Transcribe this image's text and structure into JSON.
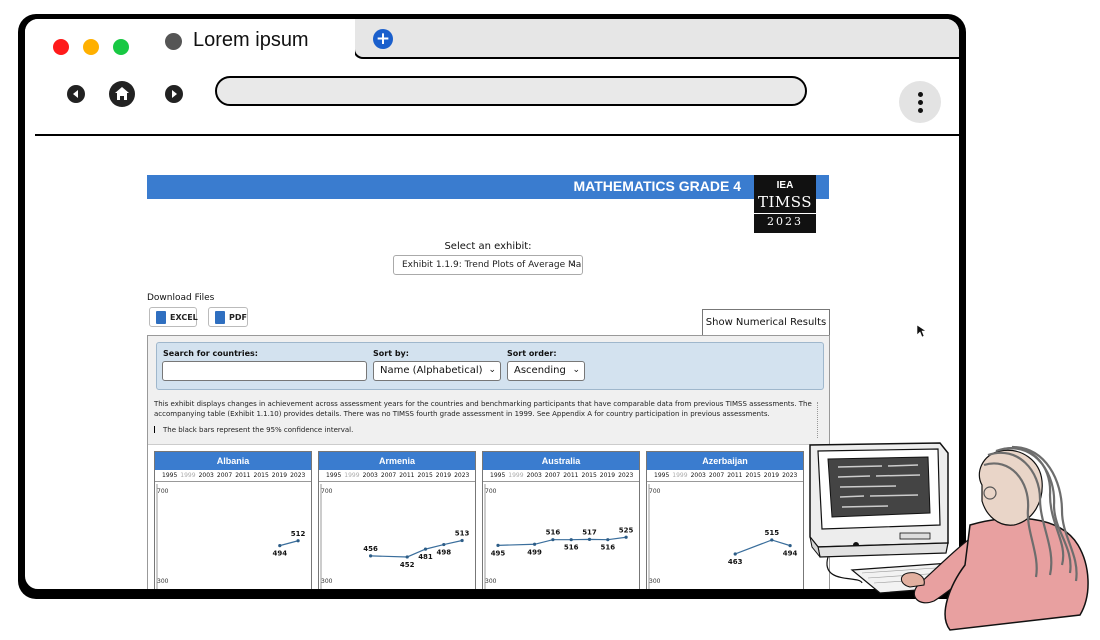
{
  "browser": {
    "tab_title": "Lorem ipsum",
    "new_tab_symbol": "+",
    "url": ""
  },
  "page": {
    "banner_title": "MATHEMATICS GRADE 4",
    "logo": {
      "org": "IEA",
      "name": "TIMSS",
      "year": "2023"
    },
    "exhibit_label": "Select an exhibit:",
    "exhibit_value": "Exhibit 1.1.9: Trend Plots of Average Ma",
    "download_label": "Download Files",
    "download_excel": "EXCEL",
    "download_pdf": "PDF",
    "show_results": "Show Numerical Results",
    "filters": {
      "search_label": "Search for countries:",
      "search_value": "",
      "sort_by_label": "Sort by:",
      "sort_by_value": "Name (Alphabetical)",
      "sort_order_label": "Sort order:",
      "sort_order_value": "Ascending"
    },
    "description": "This exhibit displays changes in achievement across assessment years for the countries and benchmarking participants that have comparable data from previous TIMSS assessments. The accompanying table (Exhibit 1.1.10) provides details. There was no TIMSS fourth grade assessment in 1999. See Appendix A for country participation in previous assessments.",
    "note": "The black bars represent the 95% confidence interval."
  },
  "colors": {
    "banner": "#3a7ccf",
    "filters_bg": "#d3e2ef",
    "accent_blue": "#1a5fcc"
  },
  "chart_data": [
    {
      "type": "line",
      "title": "Albania",
      "x": [
        "1995",
        "1999",
        "2003",
        "2007",
        "2011",
        "2015",
        "2019",
        "2023"
      ],
      "y_axis_labels": [
        "700",
        "300"
      ],
      "ylim": [
        300,
        700
      ],
      "values": [
        null,
        null,
        null,
        null,
        null,
        null,
        494,
        512
      ]
    },
    {
      "type": "line",
      "title": "Armenia",
      "x": [
        "1995",
        "1999",
        "2003",
        "2007",
        "2011",
        "2015",
        "2019",
        "2023"
      ],
      "y_axis_labels": [
        "700",
        "300"
      ],
      "ylim": [
        300,
        700
      ],
      "values": [
        null,
        null,
        456,
        null,
        452,
        481,
        498,
        513
      ]
    },
    {
      "type": "line",
      "title": "Australia",
      "x": [
        "1995",
        "1999",
        "2003",
        "2007",
        "2011",
        "2015",
        "2019",
        "2023"
      ],
      "y_axis_labels": [
        "700",
        "300"
      ],
      "ylim": [
        300,
        700
      ],
      "values": [
        495,
        null,
        499,
        516,
        516,
        517,
        516,
        525
      ]
    },
    {
      "type": "line",
      "title": "Azerbaijan",
      "x": [
        "1995",
        "1999",
        "2003",
        "2007",
        "2011",
        "2015",
        "2019",
        "2023"
      ],
      "y_axis_labels": [
        "700",
        "300"
      ],
      "ylim": [
        300,
        700
      ],
      "values": [
        null,
        null,
        null,
        null,
        463,
        null,
        515,
        494
      ]
    }
  ]
}
